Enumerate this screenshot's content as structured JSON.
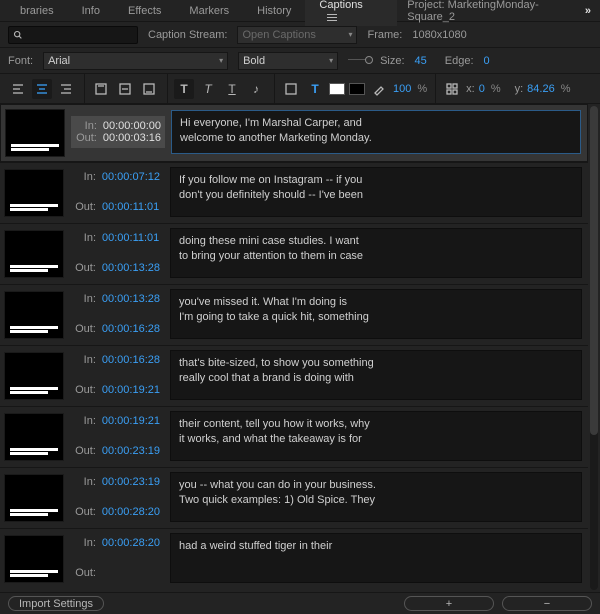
{
  "tabs": [
    "braries",
    "Info",
    "Effects",
    "Markers",
    "History",
    "Captions"
  ],
  "active_tab": "Captions",
  "project_label": "Project:",
  "project_name": "MarketingMonday-Square_2",
  "caption_stream_label": "Caption Stream:",
  "caption_stream_value": "Open Captions",
  "frame_label": "Frame:",
  "frame_value": "1080x1080",
  "font_label": "Font:",
  "font_family": "Arial",
  "font_weight": "Bold",
  "size_label": "Size:",
  "size_value": "45",
  "edge_label": "Edge:",
  "edge_value": "0",
  "opacity_value": "100",
  "opacity_pct": "%",
  "pos": {
    "x_label": "x:",
    "x_value": "0",
    "x_pct": "%",
    "y_label": "y:",
    "y_value": "84.26",
    "y_pct": "%"
  },
  "import_settings": "Import Settings",
  "tc_in_label": "In:",
  "tc_out_label": "Out:",
  "captions": [
    {
      "in": "00:00:00:00",
      "out": "00:00:03:16",
      "text": "Hi everyone, I'm Marshal Carper, and\nwelcome to another Marketing Monday."
    },
    {
      "in": "00:00:07:12",
      "out": "00:00:11:01",
      "text": "If you follow me on Instagram -- if you\ndon't you definitely should -- I've been"
    },
    {
      "in": "00:00:11:01",
      "out": "00:00:13:28",
      "text": "doing these mini case studies. I want\nto bring your attention to them in case"
    },
    {
      "in": "00:00:13:28",
      "out": "00:00:16:28",
      "text": "you've missed it. What I'm doing is\nI'm going to take a quick hit, something"
    },
    {
      "in": "00:00:16:28",
      "out": "00:00:19:21",
      "text": "that's bite-sized, to show you something\nreally cool that a brand is doing with"
    },
    {
      "in": "00:00:19:21",
      "out": "00:00:23:19",
      "text": "their content, tell you how it works, why\nit works, and what the takeaway is for"
    },
    {
      "in": "00:00:23:19",
      "out": "00:00:28:20",
      "text": "you -- what you can do in your business.\nTwo quick examples: 1) Old Spice. They"
    },
    {
      "in": "00:00:28:20",
      "out": "",
      "text": "had a weird stuffed tiger in their"
    }
  ]
}
